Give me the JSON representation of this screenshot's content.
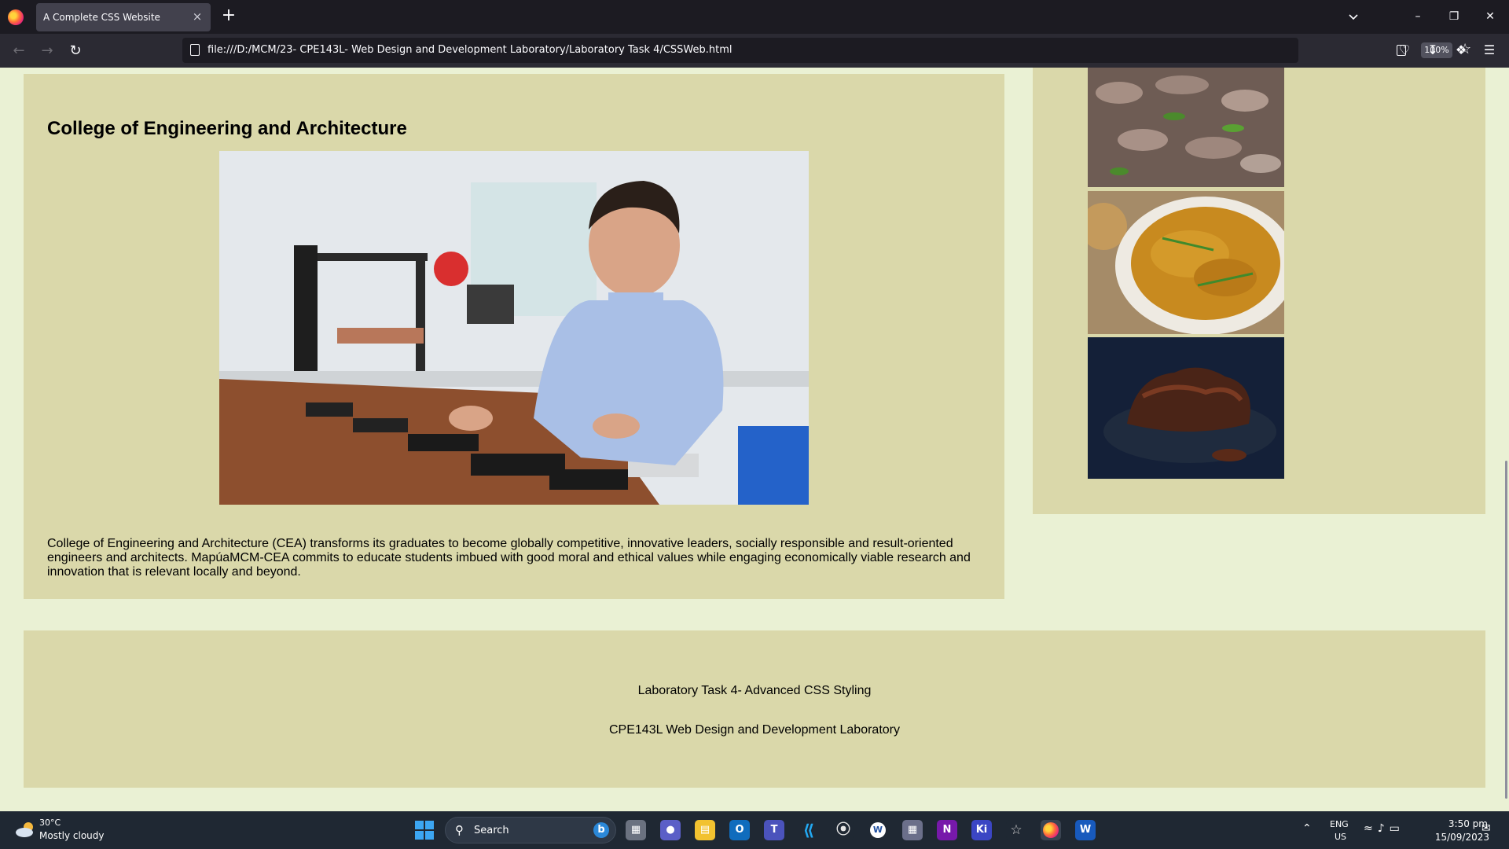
{
  "browser": {
    "tab_title": "A Complete CSS Website",
    "tab_close": "×",
    "new_tab": "+",
    "url": "file:///D:/MCM/23- CPE143L- Web Design and Development Laboratory/Laboratory Task 4/CSSWeb.html",
    "zoom": "100%"
  },
  "page": {
    "section_title": "College of Engineering and Architecture",
    "section_paragraph": "College of Engineering and Architecture (CEA) transforms its graduates to become globally competitive, innovative leaders, socially responsible and result-oriented engineers and architects. MapúaMCM-CEA commits to educate students imbued with good moral and ethical values while engaging economically viable research and innovation that is relevant locally and beyond.",
    "footer_line1": "Laboratory Task 4- Advanced CSS Styling",
    "footer_line2": "CPE143L Web Design and Development Laboratory"
  },
  "taskbar": {
    "weather_temp": "30°C",
    "weather_desc": "Mostly cloudy",
    "search_label": "Search",
    "lang_line1": "ENG",
    "lang_line2": "US",
    "time": "3:50 pm",
    "date": "15/09/2023"
  },
  "colors": {
    "page_background": "#eaf1d4",
    "box_background": "#dad8aa",
    "taskbar": "#1f2833",
    "browser_chrome": "#2b2a33"
  }
}
